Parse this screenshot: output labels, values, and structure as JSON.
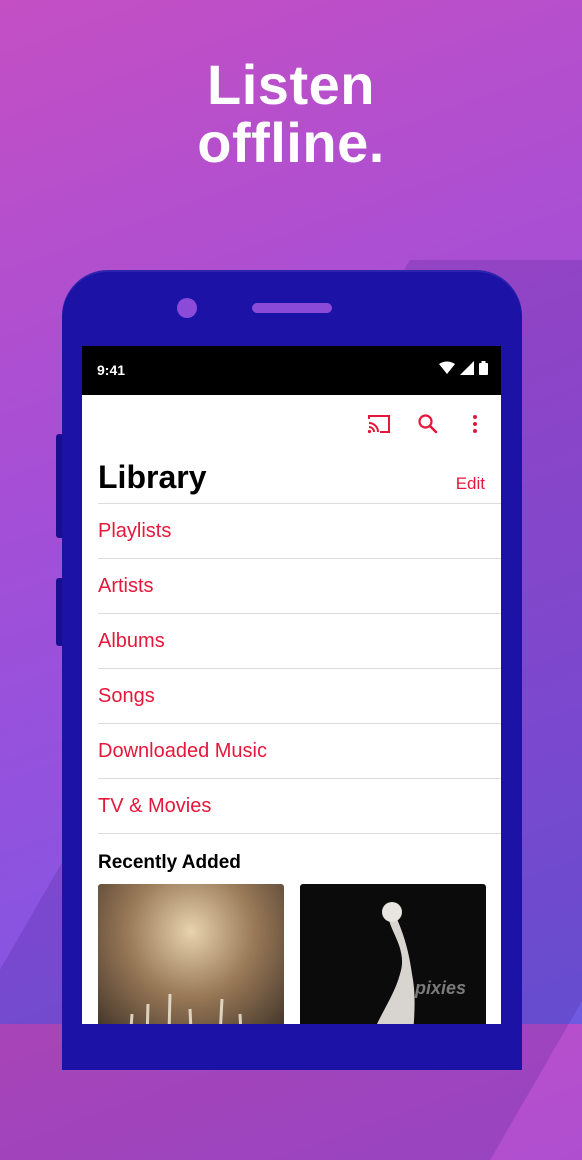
{
  "promo": {
    "headline_line1": "Listen",
    "headline_line2": "offline."
  },
  "status_bar": {
    "time": "9:41"
  },
  "toolbar": {
    "icons": [
      "cast-icon",
      "search-icon",
      "more-vert-icon"
    ]
  },
  "library": {
    "title": "Library",
    "edit_label": "Edit",
    "items": [
      {
        "label": "Playlists"
      },
      {
        "label": "Artists"
      },
      {
        "label": "Albums"
      },
      {
        "label": "Songs"
      },
      {
        "label": "Downloaded Music"
      },
      {
        "label": "TV & Movies"
      }
    ]
  },
  "recently_added": {
    "title": "Recently Added",
    "albums": [
      {
        "art_small_text": "",
        "art_brand_text": ""
      },
      {
        "art_brand_text": "pixies"
      }
    ]
  },
  "colors": {
    "accent": "#e5173a",
    "phone_body": "#1c12a6",
    "background_start": "#c44fc4",
    "background_end": "#6f5ae2"
  }
}
